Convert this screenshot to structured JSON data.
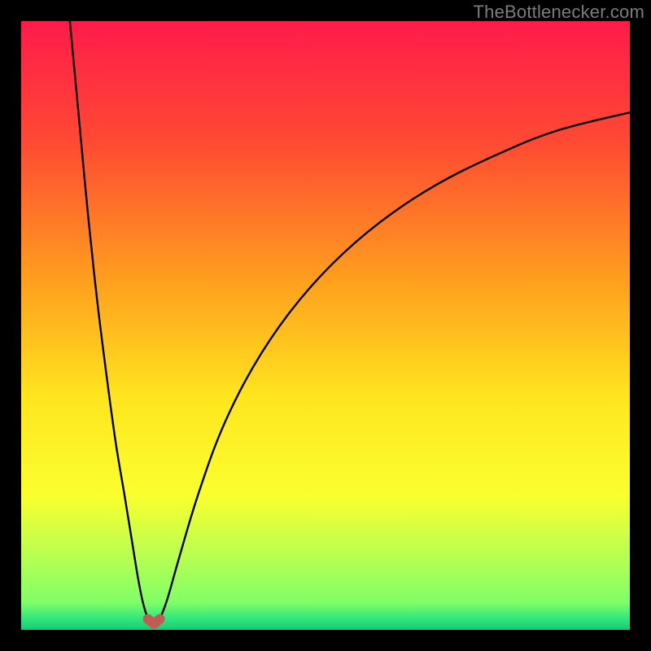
{
  "watermark": {
    "text": "TheBottlenecker.com"
  },
  "colors": {
    "frame": "#000000",
    "curve": "#000000",
    "marker_fill": "#c25a56",
    "marker_stroke": "#c25a56",
    "gradient_stops": [
      {
        "offset": 0.0,
        "color": "#ff1b4a"
      },
      {
        "offset": 0.2,
        "color": "#ff4a33"
      },
      {
        "offset": 0.42,
        "color": "#ff9d1e"
      },
      {
        "offset": 0.62,
        "color": "#ffe61e"
      },
      {
        "offset": 0.78,
        "color": "#faff2e"
      },
      {
        "offset": 0.88,
        "color": "#b7ff52"
      },
      {
        "offset": 0.955,
        "color": "#7fff67"
      },
      {
        "offset": 0.985,
        "color": "#28e37e"
      },
      {
        "offset": 1.0,
        "color": "#19c873"
      }
    ]
  },
  "chart_data": {
    "type": "line",
    "title": "",
    "xlabel": "",
    "ylabel": "",
    "xlim": [
      0,
      100
    ],
    "ylim": [
      0,
      100
    ],
    "grid": false,
    "notes": "Bottleneck-percentage-style V curve. x ≈ component balance axis, y ≈ bottleneck %. Minimum near x≈21 at y≈1. Left branch rises to y≈100 at x≈8; right branch rises to y≈85 at x=100.",
    "series": [
      {
        "name": "left-branch",
        "x": [
          8.0,
          9.5,
          11.0,
          12.5,
          14.0,
          15.5,
          17.0,
          18.3,
          19.2,
          20.0,
          20.8
        ],
        "y": [
          100.0,
          84.0,
          68.0,
          54.0,
          42.0,
          31.0,
          22.0,
          14.0,
          8.5,
          4.5,
          1.8
        ]
      },
      {
        "name": "right-branch",
        "x": [
          22.8,
          24.0,
          26.0,
          29.0,
          33.0,
          38.0,
          44.0,
          51.0,
          59.0,
          68.0,
          78.0,
          88.0,
          100.0
        ],
        "y": [
          1.8,
          5.0,
          12.0,
          22.0,
          33.0,
          43.0,
          52.0,
          60.0,
          67.0,
          73.0,
          78.0,
          82.0,
          85.0
        ]
      },
      {
        "name": "minimum-marker",
        "x": [
          20.8,
          21.8,
          22.8
        ],
        "y": [
          1.8,
          1.0,
          1.8
        ]
      }
    ]
  }
}
